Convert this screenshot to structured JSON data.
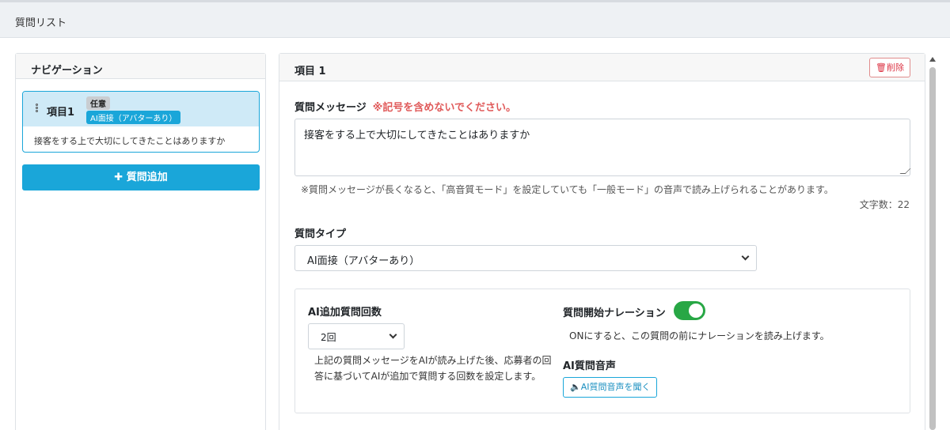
{
  "topbar": {
    "title": "質問リスト"
  },
  "nav": {
    "header": "ナビゲーション",
    "items": [
      {
        "title": "項目1",
        "badge_optional": "任意",
        "badge_type": "AI面接（アバターあり）",
        "message": "接客をする上で大切にしてきたことはありますか"
      }
    ],
    "add_button": "質問追加"
  },
  "main": {
    "title": "項目 1",
    "delete_button": "削除",
    "message_label": "質問メッセージ",
    "message_warning": "※記号を含めないでください。",
    "message_value": "接客をする上で大切にしてきたことはありますか",
    "message_note": "※質問メッセージが長くなると、「高音質モード」を設定していても「一般モード」の音声で読み上げられることがあります。",
    "char_count": "文字数：22",
    "type_label": "質問タイプ",
    "type_value": "AI面接（アバターあり）",
    "ai_followup_label": "AI追加質問回数",
    "ai_followup_value": "2回",
    "ai_followup_desc": "上記の質問メッセージをAIが読み上げた後、応募者の回答に基づいてAIが追加で質問する回数を設定します。",
    "narration_label": "質問開始ナレーション",
    "narration_on": true,
    "narration_desc": "ONにすると、この質問の前にナレーションを読み上げます。",
    "voice_label": "AI質問音声",
    "voice_button": "AI質問音声を聞く"
  },
  "colors": {
    "accent": "#1aa6d9",
    "danger": "#dc3545",
    "toggle_on": "#28a745",
    "warning_text": "#e05a5a"
  }
}
